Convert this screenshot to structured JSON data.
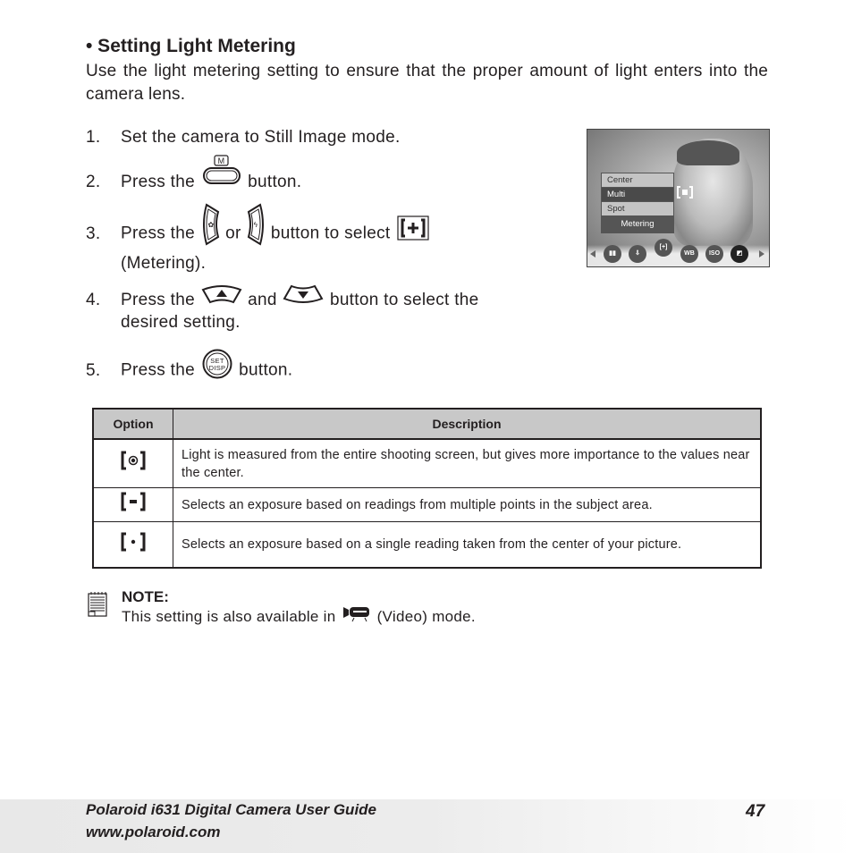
{
  "heading": "• Setting Light Metering",
  "intro": "Use the light metering setting to ensure that the proper amount of light enters into the camera lens.",
  "steps": [
    {
      "num": "1.",
      "text": "Set the camera to Still Image mode."
    },
    {
      "num": "2.",
      "pre": "Press the",
      "post": "button.",
      "icon": "menu-button-icon"
    },
    {
      "num": "3.",
      "pre": "Press the",
      "mid": "or",
      "post": "button to select",
      "cont": "(Metering).",
      "icons": [
        "left-macro-button-icon",
        "right-flash-button-icon",
        "metering-icon"
      ]
    },
    {
      "num": "4.",
      "pre": "Press the",
      "mid": "and",
      "post": "button to select the",
      "cont": "desired setting.",
      "icons": [
        "up-button-icon",
        "down-button-icon"
      ]
    },
    {
      "num": "5.",
      "pre": "Press the",
      "post": "button.",
      "icon": "set-disp-button-icon",
      "icon_text": [
        "SET",
        "DISP"
      ]
    }
  ],
  "lcd": {
    "menu_items": [
      "Center",
      "Multi",
      "Spot"
    ],
    "selected": "Multi",
    "menu_title": "Metering",
    "bar_icons": [
      "scene-icon",
      "quality-icon",
      "metering-icon",
      "wb-icon",
      "iso-icon",
      "exposure-icon"
    ],
    "wb_label": "WB",
    "iso_label": "ISO"
  },
  "table": {
    "headers": [
      "Option",
      "Description"
    ],
    "rows": [
      {
        "icon": "center-weighted-icon",
        "description": "Light is measured from the entire shooting screen, but gives more importance to the values near the center."
      },
      {
        "icon": "multi-metering-icon",
        "description": "Selects an exposure based on readings from multiple points in the subject area."
      },
      {
        "icon": "spot-metering-icon",
        "description": "Selects an exposure based on a single reading taken from the center of your picture."
      }
    ]
  },
  "note": {
    "label": "NOTE:",
    "pre": "This setting is also available in",
    "post": "(Video) mode."
  },
  "footer": {
    "title": "Polaroid i631 Digital Camera User Guide",
    "url": "www.polaroid.com",
    "page": "47"
  }
}
